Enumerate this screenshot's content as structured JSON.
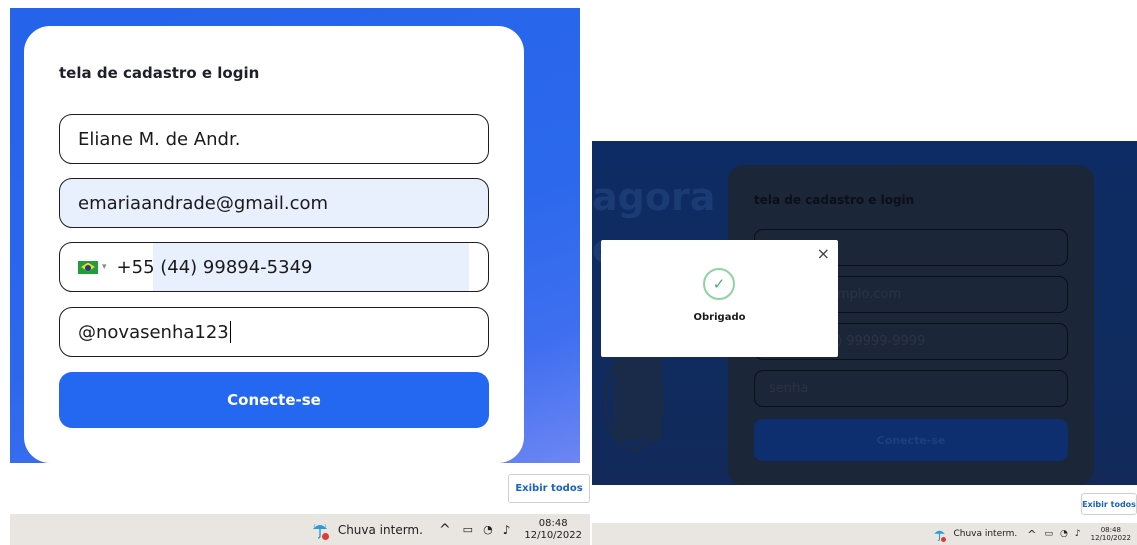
{
  "left": {
    "card_title": "tela de cadastro e login",
    "name_value": "Eliane M. de Andr.",
    "email_value": "emariaandrade@gmail.com",
    "phone_value": "+55 (44) 99894-5349",
    "password_value": "@novasenha123",
    "submit_label": "Conecte-se",
    "show_all_label": "Exibir todos",
    "taskbar": {
      "weather": "Chuva interm.",
      "chevron": "^",
      "time": "08:48",
      "date": "12/10/2022"
    }
  },
  "right": {
    "heading_line1": "agora",
    "heading_line2": "o",
    "card_title": "tela de cadastro e login",
    "email_placeholder_visible": "mplo.com",
    "phone_placeholder_visible": ") 99999-9999",
    "password_placeholder": "senha",
    "submit_label": "Conecte-se",
    "modal": {
      "close": "×",
      "check": "✓",
      "message": "Obrigado"
    },
    "show_all_label": "Exibir todos",
    "taskbar": {
      "weather": "Chuva interm.",
      "chevron": "^",
      "time": "08:48",
      "date": "12/10/2022"
    }
  }
}
